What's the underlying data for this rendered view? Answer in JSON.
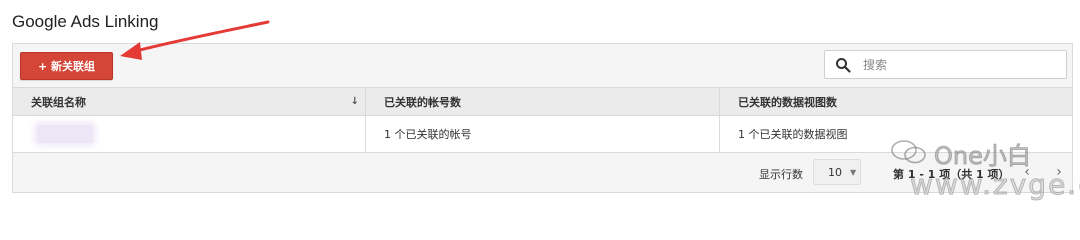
{
  "page": {
    "title": "Google Ads Linking"
  },
  "toolbar": {
    "add_label": "+ 新关联组"
  },
  "search": {
    "placeholder": "搜索"
  },
  "table": {
    "headers": [
      "关联组名称",
      "已关联的帐号数",
      "已关联的数据视图数"
    ],
    "sort_icon": "arrow-down-icon",
    "rows": [
      {
        "name": "",
        "accounts": "1 个已关联的帐号",
        "views": "1 个已关联的数据视图"
      }
    ]
  },
  "pagination": {
    "rows_label": "显示行数",
    "rows_value": "10",
    "range_text": "第 1 - 1 项（共 1 项）",
    "prev_icon": "chevron-left-icon",
    "next_icon": "chevron-right-icon"
  },
  "watermark": {
    "brand": "One小白",
    "url": "www.zvge.cn"
  },
  "colors": {
    "accent": "#d44638",
    "annotation": "#e53935",
    "header_bg": "#ebebeb",
    "panel_bg": "#f5f5f5"
  }
}
